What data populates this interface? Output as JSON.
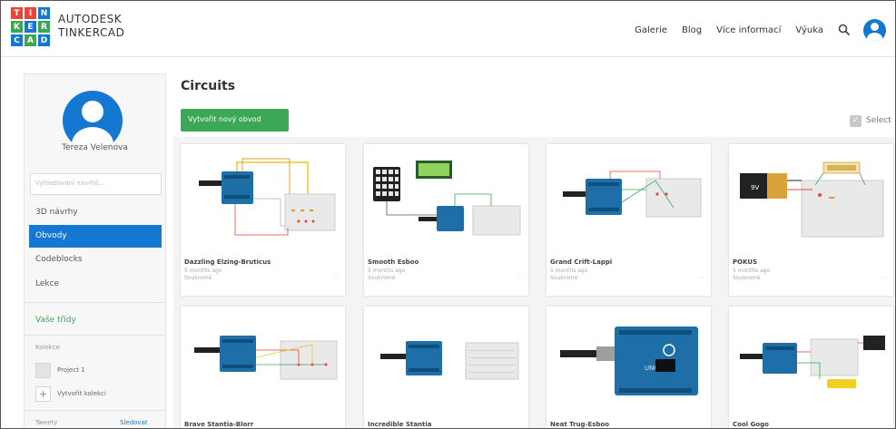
{
  "brand": {
    "logo_letters": [
      "T",
      "I",
      "N",
      "K",
      "E",
      "R",
      "C",
      "A",
      "D"
    ],
    "logo_colors": [
      "#e8463a",
      "#e8463a",
      "#1477d1",
      "#3aa855",
      "#1477d1",
      "#3aa855",
      "#1477d1",
      "#3aa855",
      "#1477d1"
    ],
    "line1": "AUTODESK",
    "line2": "TINKERCAD"
  },
  "nav": {
    "items": [
      "Galerie",
      "Blog",
      "Více informací",
      "Výuka"
    ],
    "search_icon": "search-icon",
    "avatar_icon": "user-avatar-icon"
  },
  "sidebar": {
    "username": "Tereza Velenova",
    "search_placeholder": "Vyhledávání návrhů...",
    "items": [
      "3D návrhy",
      "Obvody",
      "Codeblocks",
      "Lekce"
    ],
    "active_item": "Obvody",
    "classes_link": "Vaše třídy",
    "collections_title": "Kolekce",
    "collections": [
      "Project 1"
    ],
    "new_collection": "Vytvořit kolekci",
    "tweets_title": "Tweety",
    "follow_label": "Sledovat"
  },
  "main": {
    "title": "Circuits",
    "new_button": "Vytvořit nový obvod",
    "select_label": "Select",
    "cards": [
      {
        "name": "Dazzling Elzing-Bruticus",
        "date": "5 months ago",
        "privacy": "Soukromé",
        "more": "⋯"
      },
      {
        "name": "Smooth Esboo",
        "date": "5 months ago",
        "privacy": "Soukromé",
        "more": "⋯"
      },
      {
        "name": "Grand Crift-Lappi",
        "date": "5 months ago",
        "privacy": "Soukromé",
        "more": "⋯"
      },
      {
        "name": "POKUS",
        "date": "5 months ago",
        "privacy": "Soukromé",
        "more": "⋯"
      },
      {
        "name": "Brave Stantia-Blorr",
        "date": "",
        "privacy": "",
        "more": ""
      },
      {
        "name": "Incredible Stantia",
        "date": "",
        "privacy": "",
        "more": ""
      },
      {
        "name": "Neat Trug-Esboo",
        "date": "",
        "privacy": "",
        "more": ""
      },
      {
        "name": "Cool Gogo",
        "date": "",
        "privacy": "",
        "more": ""
      }
    ]
  },
  "colors": {
    "blue": "#1477d1",
    "green": "#3aa855",
    "red": "#e8463a",
    "arduino": "#1e6fa8",
    "breadboard": "#e9e9e9"
  }
}
